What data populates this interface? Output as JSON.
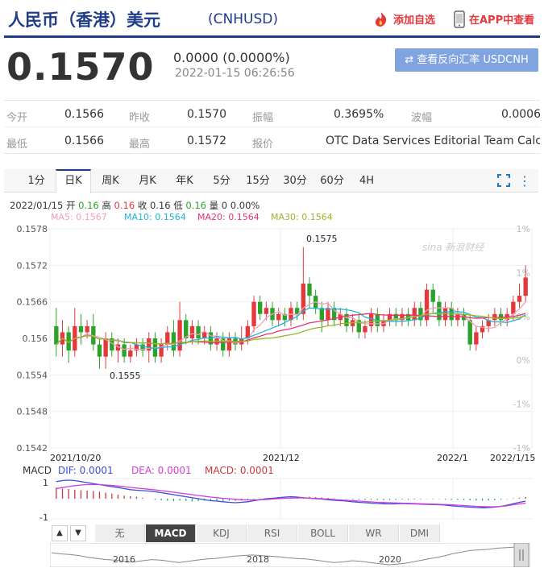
{
  "header": {
    "title": "人民币（香港）美元",
    "code": "(CNHUSD)",
    "add_favorite": "添加自选",
    "view_in_app": "在APP中查看"
  },
  "quote": {
    "price": "0.1570",
    "change": "0.0000 (0.0000%)",
    "time": "2022-01-15 06:26:56",
    "reverse_button": "⇄ 查看反向汇率 USDCNH"
  },
  "stats": [
    {
      "label": "今开",
      "value": "0.1566"
    },
    {
      "label": "昨收",
      "value": "0.1570"
    },
    {
      "label": "振幅",
      "value": "0.3695%"
    },
    {
      "label": "波幅",
      "value": "0.0006"
    },
    {
      "label": "最低",
      "value": "0.1566"
    },
    {
      "label": "最高",
      "value": "0.1572"
    },
    {
      "label": "报价",
      "value": "OTC Data Services Editorial Team Calc..."
    }
  ],
  "period_tabs": [
    "1分",
    "日K",
    "周K",
    "月K",
    "年K",
    "5分",
    "15分",
    "30分",
    "60分",
    "4H"
  ],
  "active_tab": "日K",
  "ohlc": {
    "date": "2022/01/15",
    "open_label": "开",
    "open": "0.16",
    "high_label": "高",
    "high": "0.16",
    "close_label": "收",
    "close": "0.16",
    "low_label": "低",
    "low": "0.16",
    "vol_label": "量",
    "vol": "0",
    "pct": "0.00%"
  },
  "ma_legend": [
    {
      "text": "MA5: 0.1567",
      "color": "#f4a0b8"
    },
    {
      "text": "MA10: 0.1564",
      "color": "#1db4dd"
    },
    {
      "text": "MA20: 0.1564",
      "color": "#e8336e"
    },
    {
      "text": "MA30: 0.1564",
      "color": "#9ab82a"
    }
  ],
  "watermark": "sina 新浪财经",
  "macd_legend": {
    "label": "MACD",
    "dif": "DIF: 0.0001",
    "dea": "DEA: 0.0001",
    "macd": "MACD: 0.0001"
  },
  "indicator_tabs": [
    "无",
    "MACD",
    "KDJ",
    "RSI",
    "BOLL",
    "WR",
    "DMI"
  ],
  "active_indicator": "MACD",
  "nav_arrows": [
    "▲",
    "▼"
  ],
  "overview_years": [
    "2016",
    "2018",
    "2020"
  ],
  "chart_data": {
    "type": "candlestick",
    "ylim": [
      0.1542,
      0.1578
    ],
    "y_ticks": [
      "0.1578",
      "0.1572",
      "0.1566",
      "0.156",
      "0.1554",
      "0.1548",
      "0.1542"
    ],
    "right_pct_ticks": [
      "1%",
      "1%",
      "0%",
      "0%",
      "-1%",
      "-1%"
    ],
    "x_tick_labels": [
      "2021/10/20",
      "2021/12",
      "2022/1",
      "2022/1/15"
    ],
    "annotations": [
      "0.1575",
      "0.1555"
    ],
    "up_color": "#e4393c",
    "down_color": "#2ba32b",
    "candles": [
      [
        0.1562,
        0.1559,
        0.1565,
        0.1557
      ],
      [
        0.1559,
        0.1561,
        0.1563,
        0.1557
      ],
      [
        0.1561,
        0.1558,
        0.1562,
        0.1556
      ],
      [
        0.1558,
        0.1562,
        0.1565,
        0.1557
      ],
      [
        0.1562,
        0.1561,
        0.1564,
        0.1559
      ],
      [
        0.1561,
        0.1562,
        0.1563,
        0.156
      ],
      [
        0.1562,
        0.1559,
        0.1564,
        0.1558
      ],
      [
        0.1559,
        0.1557,
        0.156,
        0.1555
      ],
      [
        0.1557,
        0.156,
        0.1561,
        0.1555
      ],
      [
        0.156,
        0.1558,
        0.1561,
        0.1557
      ],
      [
        0.1558,
        0.1559,
        0.156,
        0.1556
      ],
      [
        0.1559,
        0.1557,
        0.156,
        0.1556
      ],
      [
        0.1557,
        0.1558,
        0.1559,
        0.1556
      ],
      [
        0.1558,
        0.1559,
        0.156,
        0.1557
      ],
      [
        0.1559,
        0.1558,
        0.156,
        0.1557
      ],
      [
        0.1558,
        0.156,
        0.1561,
        0.1556
      ],
      [
        0.156,
        0.1557,
        0.1561,
        0.1556
      ],
      [
        0.1557,
        0.1559,
        0.156,
        0.1556
      ],
      [
        0.1559,
        0.1561,
        0.1562,
        0.1558
      ],
      [
        0.1561,
        0.1558,
        0.1563,
        0.1557
      ],
      [
        0.1558,
        0.1563,
        0.1566,
        0.1557
      ],
      [
        0.1563,
        0.156,
        0.1564,
        0.1559
      ],
      [
        0.156,
        0.1562,
        0.1563,
        0.1559
      ],
      [
        0.1562,
        0.156,
        0.1563,
        0.1559
      ],
      [
        0.156,
        0.1561,
        0.1562,
        0.1559
      ],
      [
        0.1561,
        0.1559,
        0.1562,
        0.1558
      ],
      [
        0.1559,
        0.156,
        0.1561,
        0.1558
      ],
      [
        0.156,
        0.1558,
        0.1561,
        0.1557
      ],
      [
        0.1558,
        0.156,
        0.1561,
        0.1557
      ],
      [
        0.156,
        0.1559,
        0.1561,
        0.1558
      ],
      [
        0.1559,
        0.156,
        0.1562,
        0.1558
      ],
      [
        0.156,
        0.1562,
        0.1563,
        0.1559
      ],
      [
        0.1562,
        0.1566,
        0.1567,
        0.1561
      ],
      [
        0.1566,
        0.1564,
        0.1567,
        0.1563
      ],
      [
        0.1564,
        0.1565,
        0.1566,
        0.1563
      ],
      [
        0.1565,
        0.1563,
        0.1566,
        0.1562
      ],
      [
        0.1563,
        0.1564,
        0.1565,
        0.1562
      ],
      [
        0.1564,
        0.1563,
        0.1565,
        0.1562
      ],
      [
        0.1563,
        0.1565,
        0.1566,
        0.1562
      ],
      [
        0.1565,
        0.1564,
        0.1566,
        0.1563
      ],
      [
        0.1564,
        0.1569,
        0.1575,
        0.1563
      ],
      [
        0.1569,
        0.1567,
        0.157,
        0.1565
      ],
      [
        0.1567,
        0.1565,
        0.1568,
        0.1564
      ],
      [
        0.1565,
        0.1563,
        0.1566,
        0.1561
      ],
      [
        0.1563,
        0.1565,
        0.1566,
        0.1562
      ],
      [
        0.1565,
        0.1563,
        0.1566,
        0.1562
      ],
      [
        0.1563,
        0.1564,
        0.1565,
        0.1562
      ],
      [
        0.1564,
        0.1562,
        0.1565,
        0.1561
      ],
      [
        0.1562,
        0.1563,
        0.1564,
        0.1561
      ],
      [
        0.1563,
        0.1561,
        0.1564,
        0.156
      ],
      [
        0.1561,
        0.1562,
        0.1563,
        0.156
      ],
      [
        0.1562,
        0.1564,
        0.1565,
        0.1561
      ],
      [
        0.1564,
        0.1562,
        0.1565,
        0.1561
      ],
      [
        0.1562,
        0.1563,
        0.1564,
        0.1561
      ],
      [
        0.1563,
        0.1564,
        0.1565,
        0.1562
      ],
      [
        0.1564,
        0.1563,
        0.1565,
        0.1562
      ],
      [
        0.1563,
        0.1564,
        0.1565,
        0.1562
      ],
      [
        0.1564,
        0.1563,
        0.1565,
        0.1562
      ],
      [
        0.1563,
        0.1565,
        0.1566,
        0.1562
      ],
      [
        0.1565,
        0.1563,
        0.1566,
        0.1562
      ],
      [
        0.1563,
        0.1568,
        0.1569,
        0.1562
      ],
      [
        0.1568,
        0.1566,
        0.1569,
        0.1564
      ],
      [
        0.1566,
        0.1563,
        0.1567,
        0.1562
      ],
      [
        0.1563,
        0.1565,
        0.1566,
        0.1562
      ],
      [
        0.1565,
        0.1563,
        0.1566,
        0.1562
      ],
      [
        0.1563,
        0.1564,
        0.1565,
        0.1562
      ],
      [
        0.1564,
        0.1563,
        0.1565,
        0.1562
      ],
      [
        0.1563,
        0.1559,
        0.1564,
        0.1558
      ],
      [
        0.1559,
        0.1561,
        0.1562,
        0.1558
      ],
      [
        0.1561,
        0.1562,
        0.1563,
        0.156
      ],
      [
        0.1562,
        0.1563,
        0.1564,
        0.1561
      ],
      [
        0.1563,
        0.1564,
        0.1565,
        0.1562
      ],
      [
        0.1564,
        0.1563,
        0.1565,
        0.1562
      ],
      [
        0.1563,
        0.1564,
        0.1565,
        0.1562
      ],
      [
        0.1564,
        0.1566,
        0.1567,
        0.1563
      ],
      [
        0.1566,
        0.1567,
        0.1569,
        0.1565
      ],
      [
        0.1567,
        0.157,
        0.1572,
        0.1566
      ]
    ]
  },
  "macd_data": {
    "ylim": [
      -1,
      1
    ],
    "ticks": [
      "1",
      "-1"
    ],
    "bars": [
      0.55,
      0.5,
      0.48,
      0.45,
      0.42,
      0.4,
      0.38,
      0.35,
      0.3,
      0.25,
      0.2,
      0.15,
      0.12,
      0.1,
      0.05,
      0.0,
      -0.05,
      -0.08,
      -0.1,
      -0.12,
      -0.1,
      -0.12,
      -0.14,
      -0.12,
      -0.1,
      -0.12,
      -0.13,
      -0.12,
      -0.1,
      -0.11,
      -0.1,
      -0.08,
      -0.05,
      -0.02,
      0.02,
      0.05,
      0.08,
      0.1,
      0.12,
      0.1,
      0.08,
      0.1,
      0.08,
      0.06,
      0.04,
      0.02,
      0.0,
      -0.02,
      -0.04,
      -0.05,
      -0.06,
      -0.05,
      -0.06,
      -0.07,
      -0.06,
      -0.05,
      -0.04,
      -0.05,
      -0.04,
      -0.03,
      -0.02,
      -0.03,
      -0.02,
      -0.04,
      -0.05,
      -0.06,
      -0.07,
      -0.08,
      -0.09,
      -0.1,
      -0.09,
      -0.08,
      -0.05,
      -0.02,
      0.02,
      0.05,
      0.08
    ],
    "dif": [
      0.85,
      0.9,
      0.92,
      0.9,
      0.85,
      0.8,
      0.75,
      0.7,
      0.65,
      0.6,
      0.55,
      0.5,
      0.45,
      0.42,
      0.4,
      0.38,
      0.35,
      0.3,
      0.25,
      0.2,
      0.15,
      0.1,
      0.05,
      0.0,
      -0.05,
      -0.1,
      -0.12,
      -0.15,
      -0.18,
      -0.2,
      -0.18,
      -0.15,
      -0.1,
      -0.05,
      0.0,
      0.02,
      0.05,
      0.08,
      0.1,
      0.08,
      0.05,
      0.02,
      0.0,
      -0.02,
      -0.05,
      -0.08,
      -0.1,
      -0.12,
      -0.15,
      -0.18,
      -0.2,
      -0.22,
      -0.24,
      -0.25,
      -0.26,
      -0.25,
      -0.24,
      -0.25,
      -0.26,
      -0.27,
      -0.28,
      -0.29,
      -0.3,
      -0.32,
      -0.35,
      -0.38,
      -0.4,
      -0.42,
      -0.44,
      -0.45,
      -0.44,
      -0.42,
      -0.38,
      -0.32,
      -0.25,
      -0.18,
      -0.12
    ],
    "dea": [
      0.5,
      0.55,
      0.6,
      0.65,
      0.68,
      0.7,
      0.7,
      0.7,
      0.68,
      0.66,
      0.63,
      0.6,
      0.56,
      0.53,
      0.5,
      0.47,
      0.44,
      0.4,
      0.36,
      0.32,
      0.28,
      0.24,
      0.2,
      0.16,
      0.12,
      0.08,
      0.05,
      0.02,
      0.0,
      -0.03,
      -0.05,
      -0.06,
      -0.06,
      -0.05,
      -0.04,
      -0.02,
      0.0,
      0.02,
      0.03,
      0.04,
      0.04,
      0.03,
      0.02,
      0.0,
      -0.02,
      -0.04,
      -0.06,
      -0.08,
      -0.1,
      -0.12,
      -0.14,
      -0.16,
      -0.18,
      -0.19,
      -0.2,
      -0.21,
      -0.22,
      -0.23,
      -0.24,
      -0.25,
      -0.26,
      -0.27,
      -0.28,
      -0.29,
      -0.3,
      -0.32,
      -0.34,
      -0.36,
      -0.38,
      -0.39,
      -0.4,
      -0.4,
      -0.38,
      -0.35,
      -0.3,
      -0.26,
      -0.22
    ]
  },
  "overview_data": [
    0.152,
    0.151,
    0.1505,
    0.1495,
    0.148,
    0.147,
    0.146,
    0.1455,
    0.1445,
    0.144,
    0.145,
    0.146,
    0.1455,
    0.1445,
    0.1435,
    0.1445,
    0.1455,
    0.1465,
    0.147,
    0.148,
    0.149,
    0.1495,
    0.15,
    0.1495,
    0.149,
    0.1485,
    0.1475,
    0.147,
    0.1465,
    0.1455,
    0.1445,
    0.1435,
    0.144,
    0.145,
    0.1445,
    0.1435,
    0.1425,
    0.1415,
    0.142,
    0.143,
    0.1445,
    0.146,
    0.1475,
    0.149,
    0.151,
    0.1525,
    0.154,
    0.1545,
    0.155,
    0.156,
    0.1565,
    0.157
  ]
}
